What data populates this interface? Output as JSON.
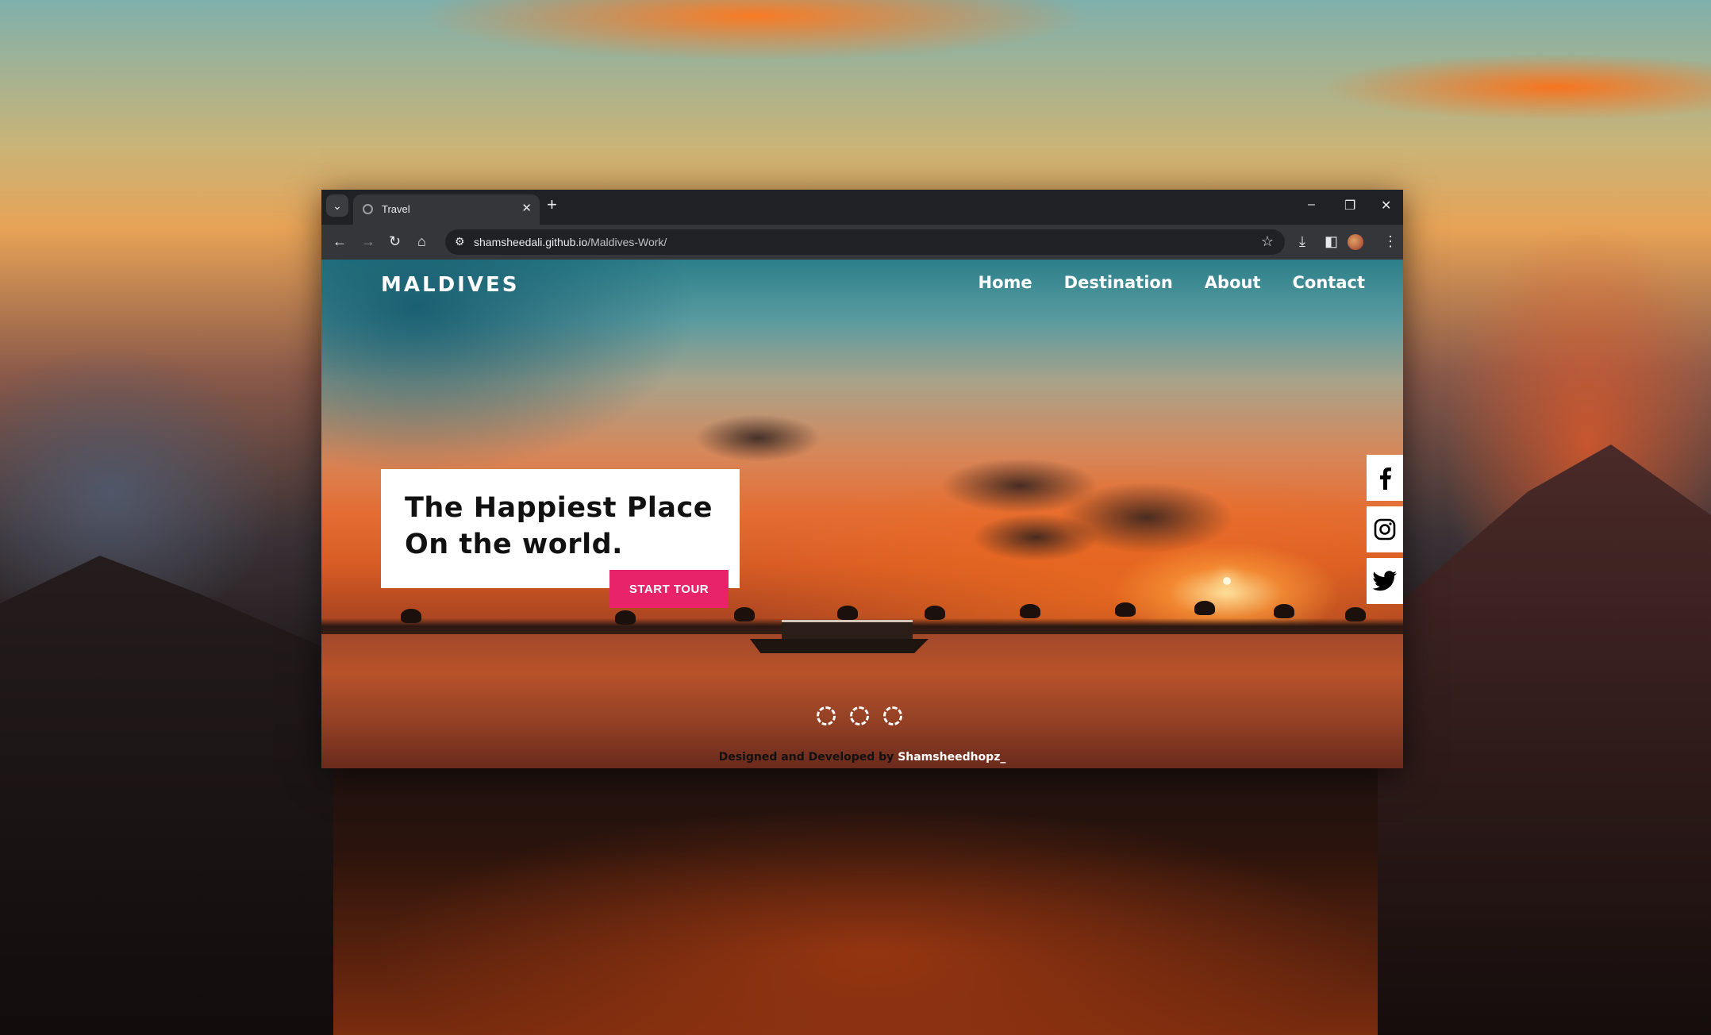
{
  "browser": {
    "tab_title": "Travel",
    "tab_list_icon": "chevron-down-icon",
    "new_tab_icon": "plus-icon",
    "url_host": "shamsheedali.github.io",
    "url_path": "/Maldives-Work/",
    "window_controls": [
      "minimize-icon",
      "restore-icon",
      "close-icon"
    ],
    "toolbar_icons": [
      "back-icon",
      "forward-icon",
      "reload-icon",
      "home-icon",
      "download-icon",
      "side-panel-icon",
      "profile-avatar",
      "more-icon"
    ]
  },
  "site": {
    "logo": "MALDIVES",
    "nav": [
      "Home",
      "Destination",
      "About",
      "Contact"
    ],
    "hero": {
      "title_line1": "The Happiest Place",
      "title_line2": "On the world.",
      "cta_label": "START TOUR"
    },
    "social": [
      "facebook-icon",
      "instagram-icon",
      "twitter-icon"
    ],
    "slider_dots": 3,
    "footer_prefix": "Designed and Developed by ",
    "footer_author": "Shamsheedhopz_"
  },
  "colors": {
    "accent": "#e8236a",
    "browser_chrome": "#202124",
    "toolbar": "#35363a"
  }
}
